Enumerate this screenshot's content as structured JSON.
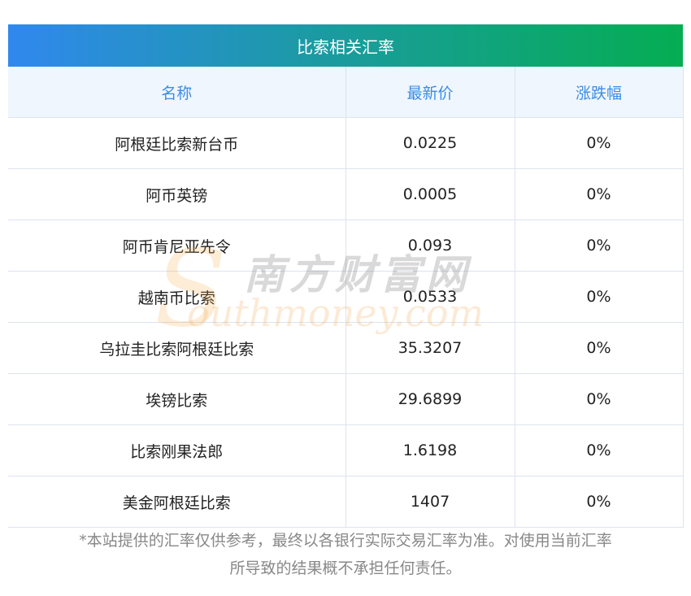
{
  "title": "比索相关汇率",
  "columns": [
    "名称",
    "最新价",
    "涨跌幅"
  ],
  "rows": [
    {
      "name": "阿根廷比索新台币",
      "price": "0.0225",
      "change": "0%"
    },
    {
      "name": "阿币英镑",
      "price": "0.0005",
      "change": "0%"
    },
    {
      "name": "阿币肯尼亚先令",
      "price": "0.093",
      "change": "0%"
    },
    {
      "name": "越南币比索",
      "price": "0.0533",
      "change": "0%"
    },
    {
      "name": "乌拉圭比索阿根廷比索",
      "price": "35.3207",
      "change": "0%"
    },
    {
      "name": "埃镑比索",
      "price": "29.6899",
      "change": "0%"
    },
    {
      "name": "比索刚果法郎",
      "price": "1.6198",
      "change": "0%"
    },
    {
      "name": "美金阿根廷比索",
      "price": "1407",
      "change": "0%"
    }
  ],
  "disclaimer_line1": "*本站提供的汇率仅供参考，最终以各银行实际交易汇率为准。对使用当前汇率",
  "disclaimer_line2": "所导致的结果概不承担任何责任。",
  "watermark": {
    "cn": "南方财富网",
    "en": "outhmoney.com",
    "s": "S"
  }
}
